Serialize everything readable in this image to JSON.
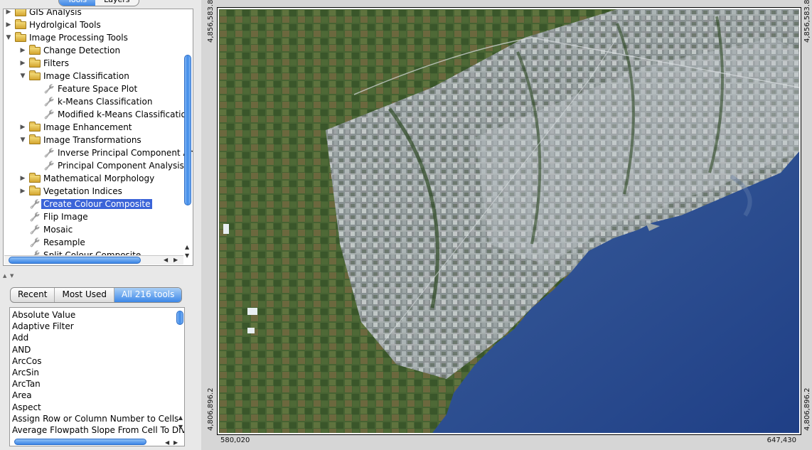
{
  "top_tabs": {
    "tools": "Tools",
    "layers": "Layers"
  },
  "tree": [
    {
      "label": "GIS Analysis",
      "type": "folder",
      "expanded": false,
      "level": 0,
      "selected": false
    },
    {
      "label": "Hydrolgical Tools",
      "type": "folder",
      "expanded": false,
      "level": 0,
      "selected": false
    },
    {
      "label": "Image Processing Tools",
      "type": "folder",
      "expanded": true,
      "level": 0,
      "selected": false
    },
    {
      "label": "Change Detection",
      "type": "folder",
      "expanded": false,
      "level": 1,
      "selected": false
    },
    {
      "label": "Filters",
      "type": "folder",
      "expanded": false,
      "level": 1,
      "selected": false
    },
    {
      "label": "Image Classification",
      "type": "folder",
      "expanded": true,
      "level": 1,
      "selected": false
    },
    {
      "label": "Feature Space Plot",
      "type": "tool",
      "level": 2,
      "selected": false
    },
    {
      "label": "k-Means Classification",
      "type": "tool",
      "level": 2,
      "selected": false
    },
    {
      "label": "Modified k-Means Classification",
      "type": "tool",
      "level": 2,
      "selected": false
    },
    {
      "label": "Image Enhancement",
      "type": "folder",
      "expanded": false,
      "level": 1,
      "selected": false
    },
    {
      "label": "Image Transformations",
      "type": "folder",
      "expanded": true,
      "level": 1,
      "selected": false
    },
    {
      "label": "Inverse Principal Component Analysis",
      "type": "tool",
      "level": 2,
      "selected": false
    },
    {
      "label": "Principal Component Analysis",
      "type": "tool",
      "level": 2,
      "selected": false
    },
    {
      "label": "Mathematical Morphology",
      "type": "folder",
      "expanded": false,
      "level": 1,
      "selected": false
    },
    {
      "label": "Vegetation Indices",
      "type": "folder",
      "expanded": false,
      "level": 1,
      "selected": false
    },
    {
      "label": "Create Colour Composite",
      "type": "tool",
      "level": 1,
      "selected": true
    },
    {
      "label": "Flip Image",
      "type": "tool",
      "level": 1,
      "selected": false
    },
    {
      "label": "Mosaic",
      "type": "tool",
      "level": 1,
      "selected": false
    },
    {
      "label": "Resample",
      "type": "tool",
      "level": 1,
      "selected": false
    },
    {
      "label": "Split Colour Composite",
      "type": "tool",
      "level": 1,
      "selected": false
    }
  ],
  "tool_tabs": {
    "recent": "Recent",
    "most_used": "Most Used",
    "all": "All 216 tools"
  },
  "tool_list": [
    "Absolute Value",
    "Adaptive Filter",
    "Add",
    "AND",
    "ArcCos",
    "ArcSin",
    "ArcTan",
    "Area",
    "Aspect",
    "Assign Row or Column Number to Cells",
    "Average Flowpath Slope From Cell To Divide"
  ],
  "map": {
    "top_left_y": "4,856,583.8",
    "top_right_y": "4,856,583.8",
    "bottom_left_y": "4,806,896.2",
    "bottom_right_y": "4,806,896.2",
    "bottom_left_x": "580,020",
    "bottom_right_x": "647,430"
  },
  "colors": {
    "selection": "#3b64d8",
    "accent": "#3d88e8",
    "water": "#2a4a8c"
  }
}
